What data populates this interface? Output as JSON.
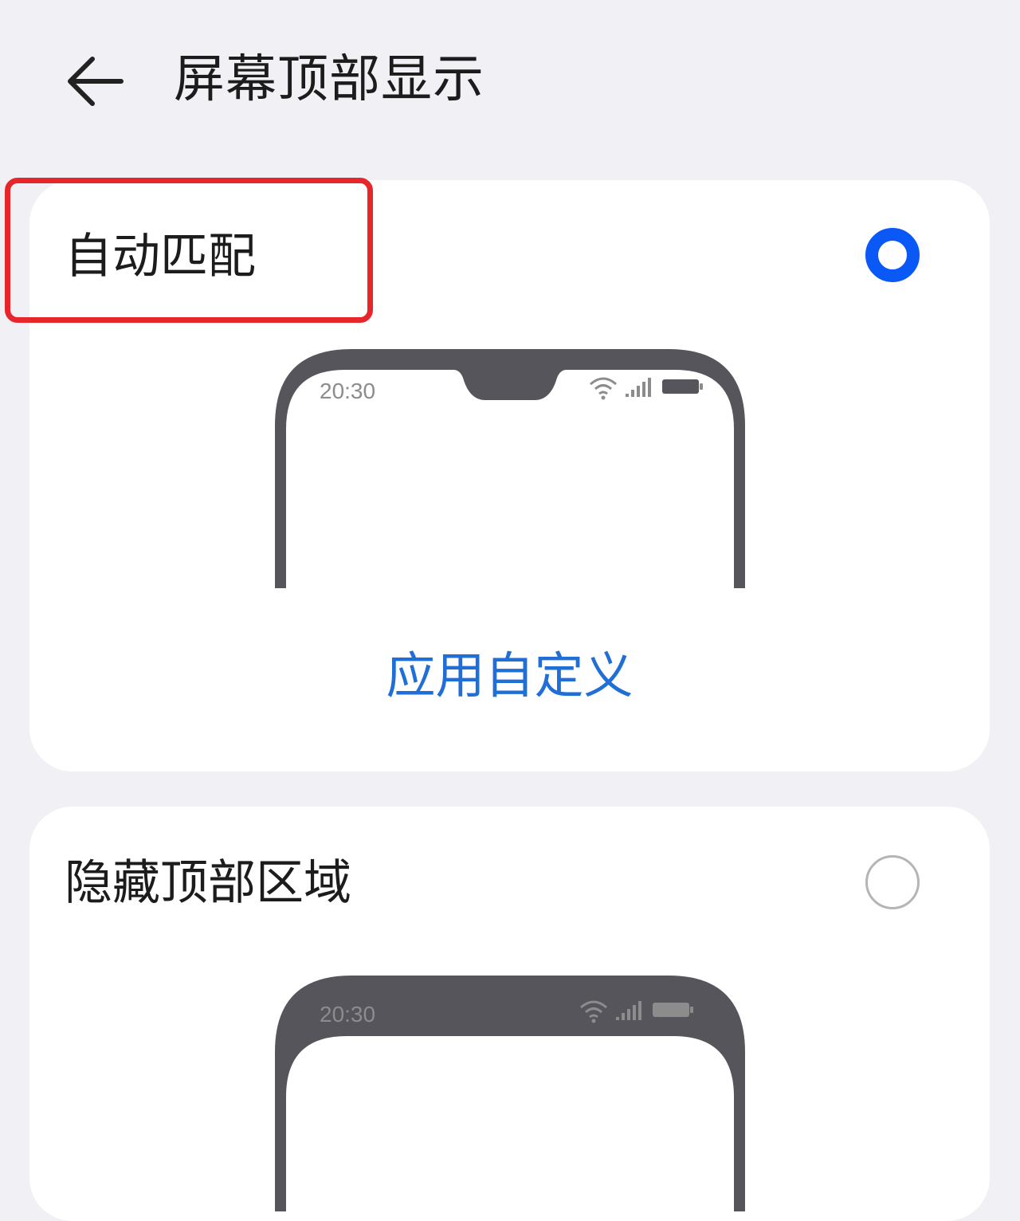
{
  "header": {
    "title": "屏幕顶部显示"
  },
  "options": [
    {
      "label": "自动匹配",
      "selected": true,
      "preview_time": "20:30",
      "link_label": "应用自定义"
    },
    {
      "label": "隐藏顶部区域",
      "selected": false,
      "preview_time": "20:30"
    }
  ],
  "colors": {
    "accent": "#0a59f7",
    "link": "#1f6fd6",
    "highlight": "#e6262b",
    "phone_frame": "#55555b"
  },
  "icons": {
    "back": "arrow-left-icon",
    "wifi": "wifi-icon",
    "signal": "signal-icon",
    "battery": "battery-icon"
  }
}
